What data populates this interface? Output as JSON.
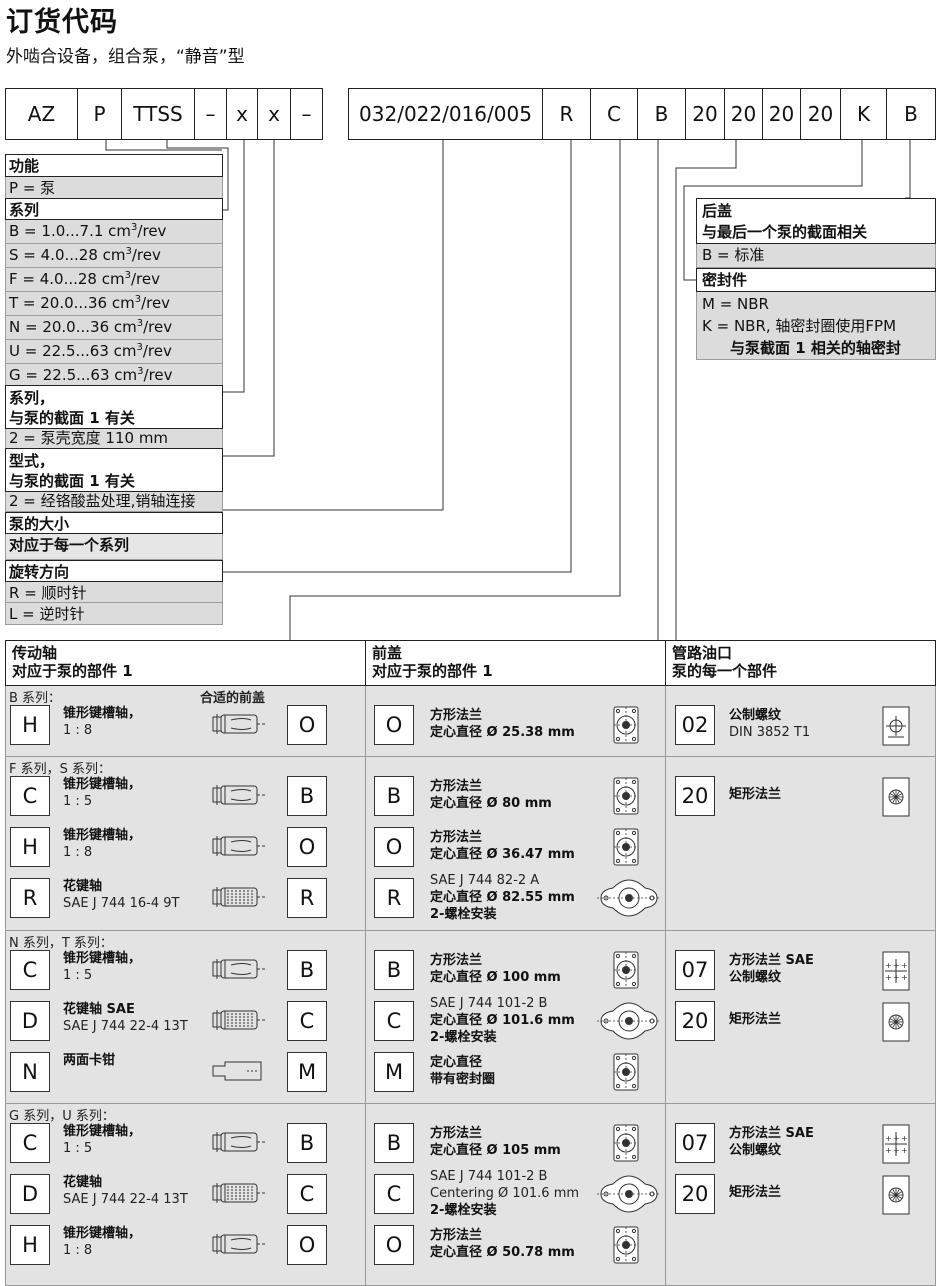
{
  "title": "订货代码",
  "subtitle": "外啮合设备，组合泵，“静音”型",
  "code": [
    "AZ",
    "P",
    "TTSS",
    "–",
    "x",
    "x",
    "–",
    "032/022/016/005",
    "R",
    "C",
    "B",
    "20",
    "20",
    "20",
    "20",
    "K",
    "B"
  ],
  "left_legend": {
    "function_head": "功能",
    "function_p": "P = 泵",
    "series_head": "系列",
    "series_rows": [
      {
        "text": "B =   1.0...7.1 cm",
        "unit": "/rev"
      },
      {
        "text": "S =   4.0...28 cm",
        "unit": "/rev"
      },
      {
        "text": "F =   4.0...28 cm",
        "unit": "/rev"
      },
      {
        "text": "T = 20.0...36 cm",
        "unit": "/rev"
      },
      {
        "text": "N = 20.0...36 cm",
        "unit": "/rev"
      },
      {
        "text": "U = 22.5...63 cm",
        "unit": "/rev"
      },
      {
        "text": "G = 22.5...63 cm",
        "unit": "/rev"
      }
    ],
    "sup3": "3",
    "series2_head_1": "系列，",
    "series2_head_2": "与泵的截面 1 有关",
    "series2_val": "2 = 泵壳宽度 110 mm",
    "type_head_1": "型式，",
    "type_head_2": "与泵的截面 1 有关",
    "type_val": "2 = 经铬酸盐处理,销轴连接",
    "size_head": "泵的大小",
    "size_val": "对应于每一个系列",
    "rot_head": "旋转方向",
    "rot_r": "R = 顺时针",
    "rot_l": "L = 逆时针"
  },
  "right_legend": {
    "cover_head_1": "后盖",
    "cover_head_2": "与最后一个泵的截面相关",
    "cover_val": "B = 标准",
    "seal_head": "密封件",
    "seal_m": "M = NBR",
    "seal_k1": "K  = NBR, 轴密封圈使用FPM",
    "seal_k2": "与泵截面 1 相关的轴密封"
  },
  "table": {
    "col1_head": "传动轴",
    "col1_sub": "对应于泵的部件 1",
    "col2_head": "前盖",
    "col2_sub": "对应于泵的部件 1",
    "col3_head": "管路油口",
    "col3_sub": "泵的每一个部件",
    "suitable_front_cover": "合适的前盖",
    "sections": [
      {
        "label": "B 系列：",
        "shafts": [
          {
            "code": "H",
            "name": "锥形键槽轴，",
            "spec": "1 : 8",
            "cover": "O"
          }
        ],
        "covers": [
          {
            "code": "O",
            "line1": "方形法兰",
            "line2": "定心直径 Ø 25.38 mm"
          }
        ],
        "ports": [
          {
            "code": "02",
            "line1": "公制螺纹",
            "line2": "DIN 3852 T1"
          }
        ]
      },
      {
        "label": "F 系列，S 系列：",
        "shafts": [
          {
            "code": "C",
            "name": "锥形键槽轴，",
            "spec": "1 : 5",
            "cover": "B"
          },
          {
            "code": "H",
            "name": "锥形键槽轴，",
            "spec": "1 : 8",
            "cover": "O"
          },
          {
            "code": "R",
            "name": "花键轴",
            "spec": "SAE J 744 16-4 9T",
            "cover": "R"
          }
        ],
        "covers": [
          {
            "code": "B",
            "line1": "方形法兰",
            "line2": "定心直径 Ø 80 mm"
          },
          {
            "code": "O",
            "line1": "方形法兰",
            "line2": "定心直径 Ø 36.47 mm"
          },
          {
            "code": "R",
            "line1": "SAE J 744 82-2 A",
            "line2": "定心直径 Ø 82.55 mm",
            "line3": "2-螺栓安装"
          }
        ],
        "ports": [
          {
            "code": "20",
            "line1": "矩形法兰",
            "line2": ""
          }
        ]
      },
      {
        "label": "N 系列，T 系列：",
        "shafts": [
          {
            "code": "C",
            "name": "锥形键槽轴，",
            "spec": "1 : 5",
            "cover": "B"
          },
          {
            "code": "D",
            "name": "花键轴 SAE",
            "spec": "SAE J 744 22-4 13T",
            "cover": "C"
          },
          {
            "code": "N",
            "name": "两面卡钳",
            "spec": "",
            "cover": "M"
          }
        ],
        "covers": [
          {
            "code": "B",
            "line1": "方形法兰",
            "line2": "定心直径 Ø 100 mm"
          },
          {
            "code": "C",
            "line1": "SAE J 744 101-2 B",
            "line2": "定心直径 Ø 101.6 mm",
            "line3": "2-螺栓安装"
          },
          {
            "code": "M",
            "line1": "定心直径",
            "line2": "带有密封圈"
          }
        ],
        "ports": [
          {
            "code": "07",
            "line1": "方形法兰 SAE",
            "line2": "公制螺纹"
          },
          {
            "code": "20",
            "line1": "矩形法兰",
            "line2": ""
          }
        ]
      },
      {
        "label": "G 系列，U 系列：",
        "shafts": [
          {
            "code": "C",
            "name": "锥形键槽轴，",
            "spec": "1 : 5",
            "cover": "B"
          },
          {
            "code": "D",
            "name": "花键轴",
            "spec": "SAE J 744 22-4 13T",
            "cover": "C"
          },
          {
            "code": "H",
            "name": "锥形键槽轴，",
            "spec": "1 : 8",
            "cover": "O"
          }
        ],
        "covers": [
          {
            "code": "B",
            "line1": "方形法兰",
            "line2": "定心直径 Ø 105 mm"
          },
          {
            "code": "C",
            "line1": "SAE J 744 101-2 B",
            "line2": "Centering Ø 101.6 mm",
            "line3": "2-螺栓安装"
          },
          {
            "code": "O",
            "line1": "方形法兰",
            "line2": "定心直径 Ø 50.78 mm"
          }
        ],
        "ports": [
          {
            "code": "07",
            "line1": "方形法兰 SAE",
            "line2": "公制螺纹"
          },
          {
            "code": "20",
            "line1": "矩形法兰",
            "line2": ""
          }
        ]
      }
    ]
  }
}
